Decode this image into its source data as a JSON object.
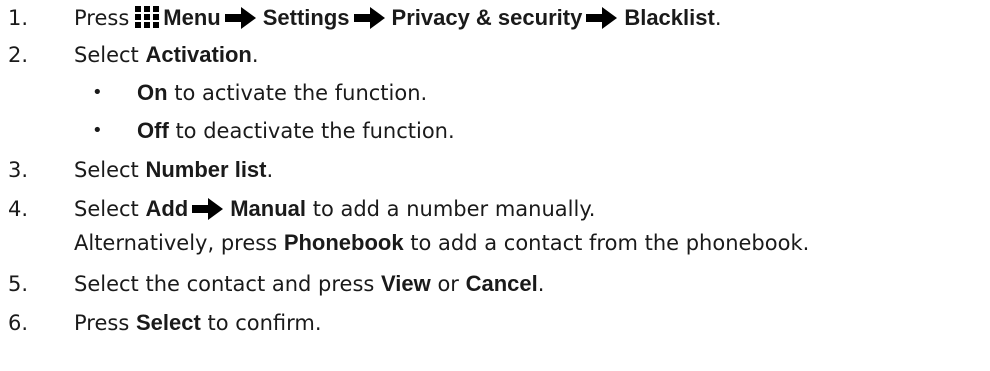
{
  "steps": [
    {
      "num": "1.",
      "press": "Press",
      "menu": "Menu",
      "settings": "Settings",
      "privacy": "Privacy & security",
      "blacklist": "Blacklist",
      "end": "."
    },
    {
      "num": "2.",
      "pre": "Select ",
      "bold": "Activation",
      "end": "."
    },
    {
      "bullet": "•",
      "bold": "On",
      "rest": " to activate the function."
    },
    {
      "bullet": "•",
      "bold": "Off",
      "rest": " to deactivate the function."
    },
    {
      "num": "3.",
      "pre": "Select ",
      "bold": "Number list",
      "end": "."
    },
    {
      "num": "4.",
      "pre": "Select ",
      "bold1": "Add",
      "bold2": "Manual",
      "rest": " to add a number manually."
    },
    {
      "pre": "Alternatively, press ",
      "bold": "Phonebook",
      "rest": " to add a contact from the phonebook."
    },
    {
      "num": "5.",
      "pre": "Select the contact and press ",
      "bold1": "View",
      "mid": " or ",
      "bold2": "Cancel",
      "end": "."
    },
    {
      "num": "6.",
      "pre": "Press ",
      "bold": "Select",
      "rest": " to confirm."
    }
  ],
  "icons": {
    "menu": "grid-menu-icon",
    "arrow": "right-arrow-icon"
  }
}
